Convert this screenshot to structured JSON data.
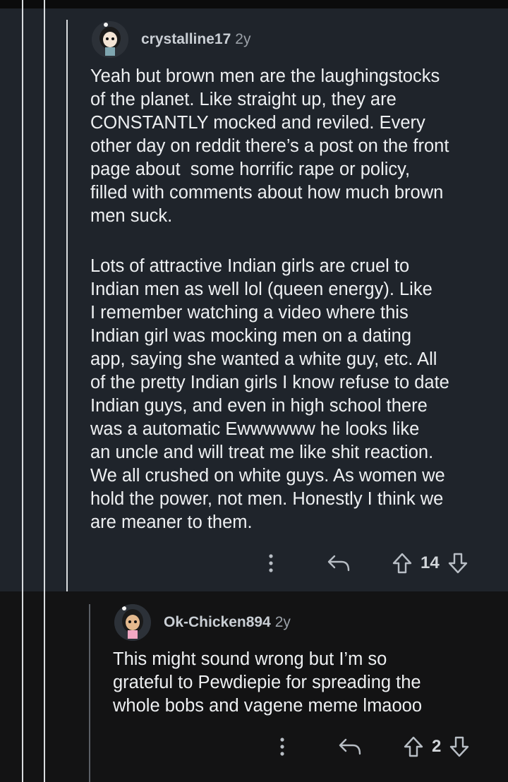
{
  "comments": [
    {
      "username": "crystalline17",
      "age": "2y",
      "paragraphs": [
        "Yeah but brown men are the laughingstocks\nof the planet. Like straight up, they are\nCONSTANTLY mocked and reviled. Every\nother day on reddit there’s a post on the front\npage about  some horrific rape or policy,\nfilled with comments about how much brown\nmen suck.",
        "Lots of attractive Indian girls are cruel to\nIndian men as well lol (queen energy). Like\nI remember watching a video where this\nIndian girl was mocking men on a dating\napp, saying she wanted a white guy, etc. All\nof the pretty Indian girls I know refuse to date\nIndian guys, and even in high school there\nwas a automatic Ewwwwww he looks like\nan uncle and will treat me like shit reaction.\nWe all crushed on white guys. As women we\nhold the power, not men. Honestly I think we\nare meaner to them."
      ],
      "votes": "14"
    },
    {
      "username": "Ok-Chicken894",
      "age": "2y",
      "paragraphs": [
        "This might sound wrong but I’m so\ngrateful to Pewdiepie for spreading the\nwhole bobs and vagene meme lmaooo"
      ],
      "votes": "2"
    }
  ],
  "icons": {
    "more": "more-vertical-icon",
    "reply": "reply-arrow-icon",
    "upvote": "upvote-arrow-icon",
    "downvote": "downvote-arrow-icon"
  },
  "colors": {
    "page_background": "#131314",
    "comment_background": "#1f242b",
    "thread_line": "#d9dcdf",
    "username": "#c9ced4"
  }
}
